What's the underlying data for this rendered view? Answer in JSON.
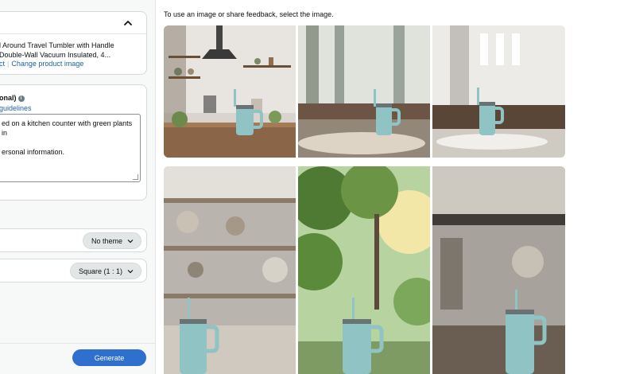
{
  "product": {
    "title": "l Around Travel Tumbler with Handle Double-Wall Vacuum Insulated, 4...",
    "select_link_partial": "ct",
    "change_link": "Change product image"
  },
  "prompt": {
    "label_partial": "onal)",
    "guidelines_partial": "guidelines",
    "text_partial": "ed on a kitchen counter with green plants in",
    "pii_partial": "ersonal information.",
    "char_partial": "."
  },
  "theme": {
    "value": "No theme"
  },
  "aspect": {
    "value": "Square (1 : 1)"
  },
  "generate_label": "Generate",
  "gallery": {
    "instruction": "To use an image or share feedback, select the image."
  },
  "colors": {
    "accent": "#2f6fce",
    "link": "#2162a1",
    "tumbler": "#8fc3c4"
  },
  "icons": {
    "collapse": "chevron-up-icon",
    "dropdown": "chevron-down-icon",
    "info": "info-icon"
  }
}
